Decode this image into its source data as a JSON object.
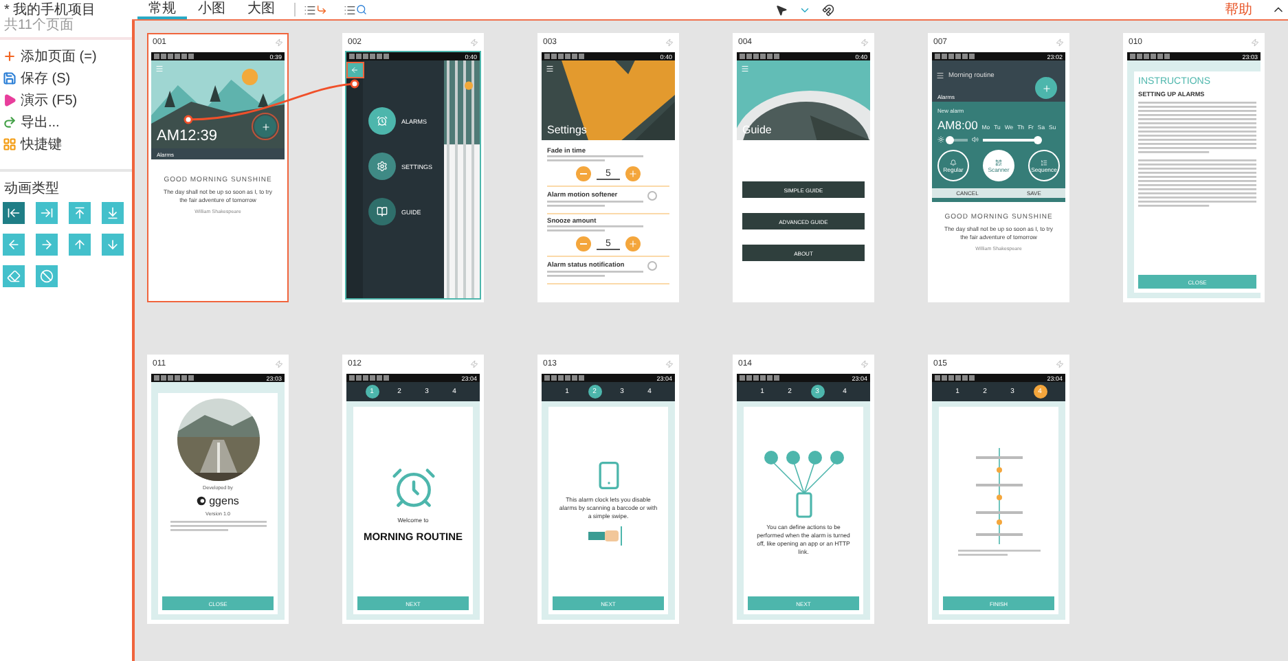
{
  "sidebar": {
    "project_title": "* 我的手机项目",
    "page_count": "共11个页面",
    "menu": [
      {
        "kind": "add",
        "label": "添加页面 (=)"
      },
      {
        "kind": "save",
        "label": "保存 (S)"
      },
      {
        "kind": "play",
        "label": "演示 (F5)"
      },
      {
        "kind": "export",
        "label": "导出..."
      },
      {
        "kind": "shortcuts",
        "label": "快捷键"
      }
    ],
    "animation_title": "动画类型",
    "animations": [
      {
        "kind": "push-left",
        "selected": true
      },
      {
        "kind": "push-right",
        "selected": false
      },
      {
        "kind": "push-up",
        "selected": false
      },
      {
        "kind": "push-down",
        "selected": false
      },
      {
        "kind": "slide-left",
        "selected": false
      },
      {
        "kind": "slide-right",
        "selected": false
      },
      {
        "kind": "slide-up",
        "selected": false
      },
      {
        "kind": "slide-down",
        "selected": false
      },
      {
        "kind": "fade",
        "selected": false
      },
      {
        "kind": "none",
        "selected": false
      }
    ]
  },
  "toolbar": {
    "tabs": [
      {
        "label": "常规",
        "selected": true
      },
      {
        "label": "小图",
        "selected": false
      },
      {
        "label": "大图",
        "selected": false
      }
    ],
    "help": "帮助"
  },
  "pages": [
    {
      "number": "001",
      "selected": true,
      "link_target": false,
      "status_time": "0:39",
      "screen": {
        "kind": "home",
        "time": "AM12:39",
        "hotspot": true,
        "tab": "Alarms",
        "heading": "GOOD MORNING SUNSHINE",
        "quote": "The day shall not be up so soon as I, to try the fair adventure of tomorrow",
        "author": "William Shakespeare"
      }
    },
    {
      "number": "002",
      "selected": false,
      "link_target": true,
      "status_time": "0:40",
      "screen": {
        "kind": "menu",
        "hotspot": true,
        "items": [
          {
            "kind": "alarm",
            "label": "ALARMS"
          },
          {
            "kind": "settings",
            "label": "SETTINGS"
          },
          {
            "kind": "guide",
            "label": "GUIDE"
          }
        ]
      }
    },
    {
      "number": "003",
      "selected": false,
      "link_target": false,
      "status_time": "0:40",
      "screen": {
        "kind": "settings",
        "title": "Settings",
        "items": [
          {
            "kind": "stepper",
            "label": "Fade in time",
            "value": "5"
          },
          {
            "kind": "toggle",
            "label": "Alarm motion softener",
            "on": false
          },
          {
            "kind": "stepper",
            "label": "Snooze amount",
            "value": "5"
          },
          {
            "kind": "toggle",
            "label": "Alarm status notification",
            "on": false
          }
        ]
      }
    },
    {
      "number": "004",
      "selected": false,
      "link_target": false,
      "status_time": "0:40",
      "screen": {
        "kind": "guide",
        "title": "Guide",
        "buttons": [
          "SIMPLE GUIDE",
          "ADVANCED GUIDE",
          "ABOUT"
        ]
      }
    },
    {
      "number": "007",
      "selected": false,
      "link_target": false,
      "status_time": "23:02",
      "screen": {
        "kind": "editor",
        "title": "Morning routine",
        "tab": "Alarms",
        "name": "New alarm",
        "time": "AM8:00",
        "days": [
          "Mo",
          "Tu",
          "We",
          "Th",
          "Fr",
          "Sa",
          "Su"
        ],
        "sliders": [
          {
            "kind": "brightness",
            "level": 0.1
          },
          {
            "kind": "volume",
            "level": 1
          }
        ],
        "modes": [
          {
            "kind": "regular",
            "label": "Regular",
            "selected": false
          },
          {
            "kind": "scanner",
            "label": "Scanner",
            "selected": true
          },
          {
            "kind": "sequence",
            "label": "Sequence",
            "selected": false
          }
        ],
        "actions": [
          "CANCEL",
          "SAVE"
        ],
        "heading": "GOOD MORNING SUNSHINE",
        "quote": "The day shall not be up so soon as I, to try the fair adventure of tomorrow",
        "author": "William Shakespeare"
      }
    },
    {
      "number": "010",
      "selected": false,
      "link_target": false,
      "status_time": "23:03",
      "screen": {
        "kind": "instructions",
        "title": "INSTRUCTIONS",
        "subtitle": "SETTING UP ALARMS",
        "button": "CLOSE"
      }
    },
    {
      "number": "011",
      "selected": false,
      "link_target": false,
      "status_time": "23:03",
      "screen": {
        "kind": "about",
        "caption": "Developed by",
        "logo": "ggens",
        "version": "Version 1.0",
        "button": "CLOSE"
      }
    },
    {
      "number": "012",
      "selected": false,
      "link_target": false,
      "status_time": "23:04",
      "screen": {
        "kind": "intro",
        "steps": [
          {
            "label": "1",
            "selected": true,
            "color": "#4db6ac"
          },
          {
            "label": "2",
            "selected": false
          },
          {
            "label": "3",
            "selected": false
          },
          {
            "label": "4",
            "selected": false
          }
        ],
        "illustration": {
          "kind": "clock"
        },
        "intro": "Welcome to",
        "title": "MORNING ROUTINE",
        "button": "NEXT"
      }
    },
    {
      "number": "013",
      "selected": false,
      "link_target": false,
      "status_time": "23:04",
      "screen": {
        "kind": "intro",
        "steps": [
          {
            "label": "1",
            "selected": false
          },
          {
            "label": "2",
            "selected": true,
            "color": "#4db6ac"
          },
          {
            "label": "3",
            "selected": false
          },
          {
            "label": "4",
            "selected": false
          }
        ],
        "illustration": {
          "kind": "scan"
        },
        "text": "This alarm clock lets you disable alarms by scanning a barcode or with a simple swipe.",
        "button": "NEXT"
      }
    },
    {
      "number": "014",
      "selected": false,
      "link_target": false,
      "status_time": "23:04",
      "screen": {
        "kind": "intro",
        "steps": [
          {
            "label": "1",
            "selected": false
          },
          {
            "label": "2",
            "selected": false
          },
          {
            "label": "3",
            "selected": true,
            "color": "#4db6ac"
          },
          {
            "label": "4",
            "selected": false
          }
        ],
        "illustration": {
          "kind": "actions"
        },
        "text": "You can define actions to be performed when the alarm is turned off, like opening an app or an HTTP link.",
        "button": "NEXT"
      }
    },
    {
      "number": "015",
      "selected": false,
      "link_target": false,
      "status_time": "23:04",
      "screen": {
        "kind": "intro",
        "steps": [
          {
            "label": "1",
            "selected": false
          },
          {
            "label": "2",
            "selected": false
          },
          {
            "label": "3",
            "selected": false
          },
          {
            "label": "4",
            "selected": true,
            "color": "#f4a63c"
          }
        ],
        "illustration": {
          "kind": "sequence"
        },
        "button": "FINISH"
      }
    }
  ]
}
